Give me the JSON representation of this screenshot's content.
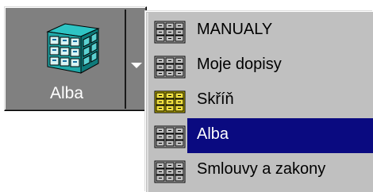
{
  "button": {
    "label": "Alba",
    "icon": "filing-cabinet-cube-icon",
    "dropdown_icon": "dropdown-arrow-icon"
  },
  "menu": {
    "items": [
      {
        "label": "MANUALY",
        "icon": "cabinet-icon",
        "selected": false
      },
      {
        "label": "Moje dopisy",
        "icon": "cabinet-icon",
        "selected": false
      },
      {
        "label": "Skříň",
        "icon": "cabinet-yellow-icon",
        "selected": false
      },
      {
        "label": "Alba",
        "icon": "cabinet-icon",
        "selected": true
      },
      {
        "label": "Smlouvy a zakony",
        "icon": "cabinet-icon",
        "selected": false
      }
    ]
  },
  "colors": {
    "button_face": "#808080",
    "menu_face": "#c0c0c0",
    "selection": "#0a0a80",
    "selection_text": "#ffffff",
    "cube_teal": "#20b2aa"
  }
}
